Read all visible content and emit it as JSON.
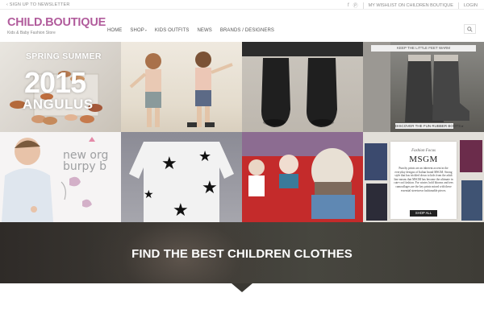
{
  "topbar": {
    "newsletter": "SIGN UP TO NEWSLETTER",
    "wishlist": "MY WISHLIST ON CHILDREN BOUTIQUE",
    "login": "LOGIN",
    "social_icons": [
      "facebook-icon",
      "pinterest-icon"
    ]
  },
  "header": {
    "logo": "CHILD.BOUTIQUE",
    "tagline": "Kids & Baby Fashion Store",
    "brand_color": "#b15c9c",
    "nav": [
      {
        "label": "HOME"
      },
      {
        "label": "SHOP"
      },
      {
        "label": "KIDS OUTFITS"
      },
      {
        "label": "NEWS"
      },
      {
        "label": "BRANDS / DESIGNERS"
      }
    ],
    "search_icon": "search-icon"
  },
  "grid": {
    "tile1": {
      "line1": "SPRING SUMMER",
      "year": "2015",
      "brand": "ANGULUS"
    },
    "tile4": {
      "banner": "KEEP THE LITTLE FEET WARM",
      "cta": "DISCOVER THE FUN RUBBER BOOTS ▸"
    },
    "tile5": {
      "line1": "new org",
      "line2": "burpy b"
    },
    "tile8": {
      "eyebrow": "Fashion Focus",
      "title": "MSGM",
      "body": "Punchy prints are an inherent accent in the everyday designs of Italian brand MSGM. Strong style that has trickled down to kids from the adult line means that MSGM has become the ultimate in cute-cool fashion. For winter, bold blooms and tees camouflages are the key prints mixed with these essential streetwear fashionable pieces.",
      "button": "SHOP ALL"
    }
  },
  "hero": {
    "title": "FIND THE BEST CHILDREN CLOTHES"
  }
}
